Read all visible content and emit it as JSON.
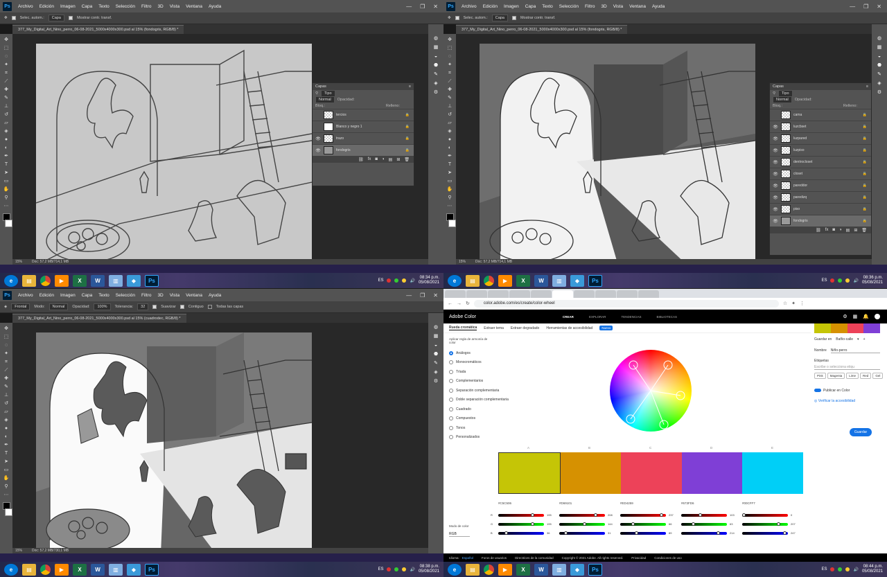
{
  "photoshop": {
    "menu": [
      "Archivo",
      "Edición",
      "Imagen",
      "Capa",
      "Texto",
      "Selección",
      "Filtro",
      "3D",
      "Vista",
      "Ventana",
      "Ayuda"
    ],
    "logo": "Ps",
    "doc_title_1": "377_My_Digital_Art_Nino_perro_06-08-2021_5000x4000x300.psd al 15% (fondogris, RGB/8) *",
    "doc_title_3": "377_My_Digital_Art_Nino_perro_06-08-2021_5000x4000x300.psd al 15% (cuadrodec, RGB/8) *",
    "options_move": {
      "auto_select": "Selec. autom.:",
      "target": "Capa",
      "transform": "Mostrar contr. transf."
    },
    "options_bucket": {
      "fill": "Frontal",
      "mode_label": "Modo:",
      "mode": "Normal",
      "opacity_label": "Opacidad:",
      "opacity": "100%",
      "tolerance_label": "Tolerancia:",
      "tolerance": "32",
      "smooth": "Suavizar",
      "contiguous": "Contiguo",
      "all_layers": "Todas las capas"
    },
    "status_q1": {
      "zoom": "15%",
      "doc": "Doc: 57,2 MB/714,1 MB"
    },
    "status_q2": {
      "zoom": "15%",
      "doc": "Doc: 57,2 MB/714,1 MB"
    },
    "status_q3": {
      "zoom": "15%",
      "doc": "Doc: 57,2 MB/730,1 MB"
    },
    "layers_panel": {
      "title": "Capas",
      "filter": "Tipo",
      "blend": "Normal",
      "opacity_label": "Opacidad:",
      "lock_label": "Bloq.:",
      "fill_label": "Relleno:",
      "layers_q1": [
        {
          "name": "tercios",
          "visible": false,
          "thumb": "checker"
        },
        {
          "name": "Blanco y negro 1",
          "visible": false,
          "thumb": "white"
        },
        {
          "name": "trazo",
          "visible": true,
          "thumb": "checker"
        },
        {
          "name": "fondogris",
          "visible": true,
          "thumb": "grey"
        }
      ],
      "layers_q2": [
        {
          "name": "cama",
          "visible": false,
          "thumb": "checker"
        },
        {
          "name": "luzcbset",
          "visible": true,
          "thumb": "checker"
        },
        {
          "name": "luzpared",
          "visible": true,
          "thumb": "checker"
        },
        {
          "name": "luzpiso",
          "visible": true,
          "thumb": "checker"
        },
        {
          "name": "dentrocloset",
          "visible": true,
          "thumb": "checker"
        },
        {
          "name": "closet",
          "visible": true,
          "thumb": "checker"
        },
        {
          "name": "pareddor",
          "visible": true,
          "thumb": "checker"
        },
        {
          "name": "paredizq",
          "visible": true,
          "thumb": "checker"
        },
        {
          "name": "piso",
          "visible": true,
          "thumb": "checker"
        },
        {
          "name": "fondogris",
          "visible": true,
          "thumb": "grey"
        }
      ]
    }
  },
  "taskbar": {
    "lang": "ES",
    "clock_q1": {
      "time": "08:34 p.m.",
      "date": "05/08/2021"
    },
    "clock_q2": {
      "time": "08:36 p.m.",
      "date": "05/08/2021"
    },
    "clock_q3": {
      "time": "08:38 p.m.",
      "date": "05/08/2021"
    },
    "clock_q4": {
      "time": "08:44 p.m.",
      "date": "05/08/2021"
    }
  },
  "browser": {
    "url": "color.adobe.com/es/create/color-wheel",
    "site_name": "Adobe Color",
    "nav": [
      "CREAR",
      "EXPLORAR",
      "TENDENCIAS",
      "BIBLIOTECAS"
    ],
    "subtabs": [
      "Rueda cromática",
      "Extraer tema",
      "Extraer degradado",
      "Herramientas de accesibilidad"
    ],
    "new_badge": "Nuevo",
    "harmony_label": "Aplicar regla de armonía de color",
    "harmony_rules": [
      "Análogos",
      "Monocromáticos",
      "Tríada",
      "Complementarios",
      "Separación complementaria",
      "Doble separación complementaria",
      "Cuadrado",
      "Compuestos",
      "Tonos",
      "Personalizados"
    ],
    "letters": [
      "A",
      "B",
      "C",
      "D",
      "E"
    ],
    "swatches": [
      "#C5C506",
      "#D69101",
      "#ED4259",
      "#7F3FD6",
      "#00CFF7"
    ],
    "hex_labels": [
      "#C5C506",
      "#D69101",
      "#ED4259",
      "#673FD6",
      "#00CFF7"
    ],
    "rgb_values": [
      [
        195,
        195,
        36
      ],
      [
        208,
        144,
        31
      ],
      [
        237,
        66,
        89
      ],
      [
        103,
        63,
        214
      ],
      [
        0,
        207,
        247
      ]
    ],
    "rgb_letters": [
      "R",
      "G",
      "B"
    ],
    "color_mode_label": "Modo de color",
    "color_mode": "RGB",
    "save_in_label": "Guardar en",
    "save_in": "Bañio-calle",
    "name_label": "Nombre",
    "name_value": "Niño-perro",
    "tags_label": "Etiquetas",
    "tags_placeholder": "Escribe o selecciona etiqu",
    "tags": [
      "Pink",
      "Magenta",
      "Lime",
      "Red",
      "Gel"
    ],
    "publish": "Publicar en Color",
    "verify": "Verificar la accesibilidad",
    "save_btn": "Guardar",
    "footer": [
      "Idioma:",
      "Español",
      "Foros de usuarios",
      "Directrices de la comunidad",
      "Copyright © 2021 Adobe. All rights reserved.",
      "Privacidad",
      "Condiciones de uso"
    ]
  }
}
